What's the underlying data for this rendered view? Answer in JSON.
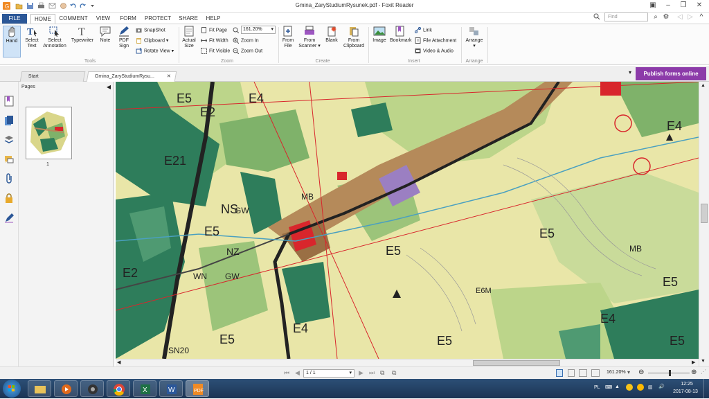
{
  "window": {
    "title": "Gmina_ZaryStudiumRysunek.pdf - Foxit Reader"
  },
  "menu": {
    "tabs": [
      "FILE",
      "HOME",
      "COMMENT",
      "VIEW",
      "FORM",
      "PROTECT",
      "SHARE",
      "HELP"
    ],
    "active": "HOME",
    "find_placeholder": "Find"
  },
  "ribbon": {
    "tools": {
      "group_label": "Tools",
      "hand": "Hand",
      "select_text": [
        "Select",
        "Text"
      ],
      "select_annotation": [
        "Select",
        "Annotation"
      ],
      "typewriter": "Typewriter",
      "note": "Note",
      "pdf_sign": [
        "PDF",
        "Sign"
      ],
      "snapshot": "SnapShot",
      "clipboard": "Clipboard",
      "rotate_view": "Rotate View"
    },
    "zoom": {
      "group_label": "Zoom",
      "actual_size": [
        "Actual",
        "Size"
      ],
      "fit_page": "Fit Page",
      "fit_width": "Fit Width",
      "fit_visible": "Fit Visible",
      "zoom_value": "161.20%",
      "zoom_in": "Zoom In",
      "zoom_out": "Zoom Out"
    },
    "create": {
      "group_label": "Create",
      "from_file": [
        "From",
        "File"
      ],
      "from_scanner": [
        "From",
        "Scanner"
      ],
      "blank": "Blank",
      "from_clipboard": [
        "From",
        "Clipboard"
      ]
    },
    "insert": {
      "group_label": "Insert",
      "image": "Image",
      "bookmark": "Bookmark",
      "link": "Link",
      "file_attachment": "File Attachment",
      "video_audio": "Video & Audio"
    },
    "arrange": {
      "group_label": "Arrange",
      "arrange": "Arrange"
    }
  },
  "doc_tabs": {
    "start": "Start",
    "document": "Gmina_ZaryStudiumRysu..."
  },
  "publish_button": "Publish forms online",
  "pages_panel": {
    "title": "Pages",
    "page_number": "1"
  },
  "map_labels": [
    "E5",
    "E2",
    "E4",
    "E21",
    "MB",
    "NS",
    "GW",
    "E5",
    "E2",
    "NZ",
    "WN",
    "GW",
    "E5",
    "E4",
    "E5",
    "E4",
    "E5",
    "MB",
    "E5",
    "E6M",
    "E5",
    "SN20",
    "E4",
    "E5"
  ],
  "status": {
    "page_indicator": "1 / 1",
    "zoom": "161.20%"
  },
  "taskbar": {
    "language": "PL",
    "time": "12:25",
    "date": "2017-08-13"
  },
  "colors": {
    "ribbon_file_tab": "#2b5797",
    "publish_button": "#8c3ba9",
    "taskbar": "#1f3a5e",
    "map_base": "#e9e6a8",
    "map_forest": "#2e7d5b",
    "map_settlement": "#b58a5a"
  }
}
